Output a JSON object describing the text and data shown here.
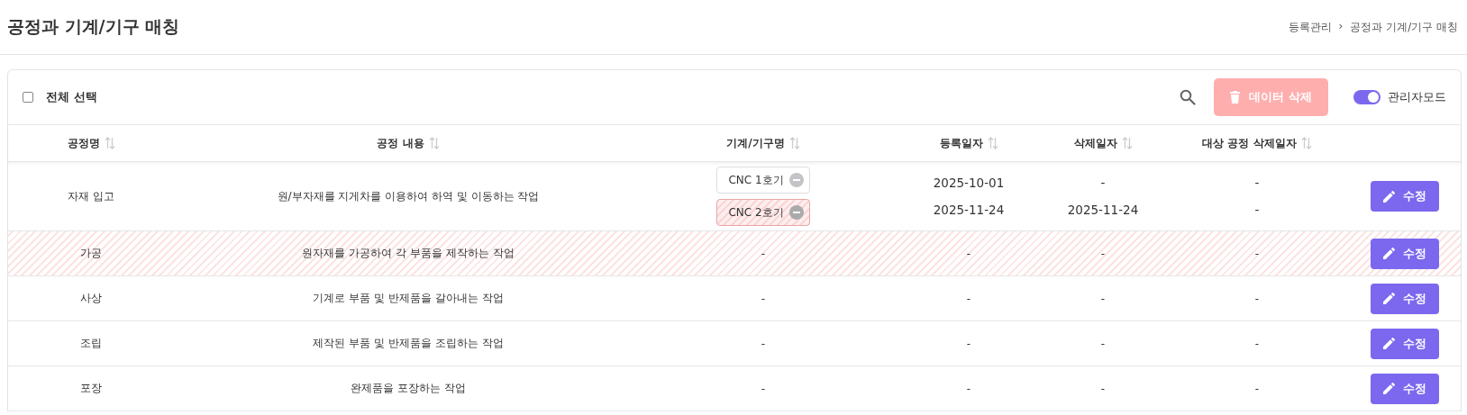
{
  "page_title": "공정과 기계/기구 매칭",
  "breadcrumb": [
    "등록관리",
    "공정과 기계/기구 매칭"
  ],
  "breadcrumb_separator": "›",
  "toolbar": {
    "select_all": {
      "label": "전체 선택",
      "checked": false
    },
    "delete_button": {
      "label": "데이터 삭제",
      "disabled": true
    },
    "admin_mode": {
      "label": "관리자모드",
      "on": true
    }
  },
  "columns": [
    {
      "label": "공정명",
      "sortable": true
    },
    {
      "label": "공정 내용",
      "sortable": true
    },
    {
      "label": "기계/기구명",
      "sortable": true
    },
    {
      "label": "등록일자",
      "sortable": true
    },
    {
      "label": "삭제일자",
      "sortable": true
    },
    {
      "label": "대상 공정 삭제일자",
      "sortable": true
    }
  ],
  "rows": [
    {
      "process": "자재 입고",
      "description": "원/부자재를 지게차를 이용하여 하역 및 이동하는 작업",
      "deleted": false,
      "machines": [
        {
          "name": "CNC 1호기",
          "deleted": false,
          "registered": "2025-10-01",
          "removed": "-",
          "process_removed": "-"
        },
        {
          "name": "CNC 2호기",
          "deleted": true,
          "registered": "2025-11-24",
          "removed": "2025-11-24",
          "process_removed": "-"
        }
      ],
      "edit_label": "수정"
    },
    {
      "process": "가공",
      "description": "원자재를 가공하여 각 부품을 제작하는 작업",
      "deleted": true,
      "empty_cells": [
        "-",
        "-",
        "-",
        "-"
      ],
      "edit_label": "수정"
    },
    {
      "process": "사상",
      "description": "기계로 부품 및 반제품을 갈아내는 작업",
      "deleted": false,
      "empty_cells": [
        "-",
        "-",
        "-",
        "-"
      ],
      "edit_label": "수정"
    },
    {
      "process": "조립",
      "description": "제작된 부품 및 반제품을 조립하는 작업",
      "deleted": false,
      "empty_cells": [
        "-",
        "-",
        "-",
        "-"
      ],
      "edit_label": "수정"
    },
    {
      "process": "포장",
      "description": "완제품을 포장하는 작업",
      "deleted": false,
      "empty_cells": [
        "-",
        "-",
        "-",
        "-"
      ],
      "edit_label": "수정"
    }
  ]
}
